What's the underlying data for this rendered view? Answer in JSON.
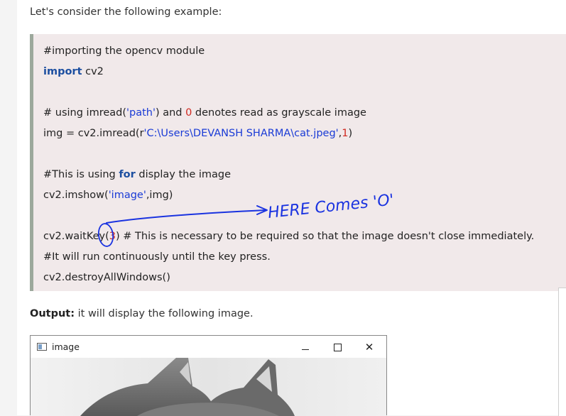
{
  "intro_text": "Let's consider the following example:",
  "code": {
    "line1": "#importing the opencv module",
    "line2_kw": "import",
    "line2_rest": " cv2",
    "line3_a": "# using imread(",
    "line3_str": "'path'",
    "line3_b": ") and ",
    "line3_num": "0",
    "line3_c": " denotes read as  grayscale image",
    "line4_a": "img = cv2.imread(r",
    "line4_str": "'C:\\Users\\DEVANSH SHARMA\\cat.jpeg'",
    "line4_b": ",",
    "line4_num": "1",
    "line4_c": ")",
    "line5_a": "#This is using ",
    "line5_kw": "for",
    "line5_b": " display the image",
    "line6_a": "cv2.imshow(",
    "line6_str": "'image'",
    "line6_b": ",img)",
    "line7_a": "cv2.waitKey(",
    "line7_num": "3",
    "line7_b": ") # This is necessary to be required so that the image doesn't close immediately.",
    "line8": "#It will run continuously until the key press.",
    "line9": "cv2.destroyAllWindows()"
  },
  "annotation": {
    "text": "HERE Comes 'O'",
    "color": "#1a33e0"
  },
  "output": {
    "label": "Output:",
    "text": " it will display the following image."
  },
  "image_window": {
    "title": "image",
    "minimize_icon": "minimize-icon",
    "maximize_icon": "maximize-icon",
    "close_icon": "close-icon",
    "close_glyph": "✕"
  },
  "colors": {
    "code_background": "#f1e9ea",
    "code_border": "#9ca89c",
    "keyword": "#1d4fa0",
    "string": "#1a3bd6",
    "number": "#d0281f"
  }
}
